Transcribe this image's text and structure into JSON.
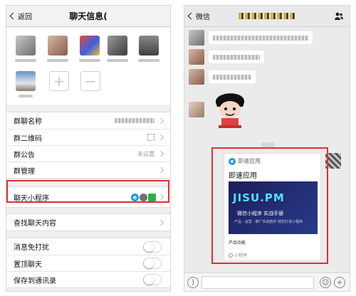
{
  "left": {
    "nav": {
      "back_label": "返回",
      "title": "聊天信息("
    },
    "rows_a": [
      {
        "label": "群聊名称"
      },
      {
        "label": "群二维码"
      },
      {
        "label": "群公告",
        "value": "未设置"
      },
      {
        "label": "群管理"
      }
    ],
    "mini_program": {
      "label": "聊天小程序"
    },
    "search": {
      "label": "查找聊天内容"
    },
    "toggles": [
      {
        "label": "消息免打扰"
      },
      {
        "label": "置顶聊天"
      },
      {
        "label": "保存到通讯录"
      }
    ]
  },
  "right": {
    "nav": {
      "back_label": "微信"
    },
    "card": {
      "header": "即速应用",
      "title": "即速应用",
      "brand": "JISU.PM",
      "subtitle": "微信小程序 实战手册",
      "features": "产品 · 运营 · 推广实战剖析 轻松打造小程序",
      "footer": "产品功能",
      "tag": "小程序"
    }
  },
  "colors": {
    "highlight": "#e03030",
    "brand": "#1a99e8",
    "card_bg": "#1c1f57"
  }
}
